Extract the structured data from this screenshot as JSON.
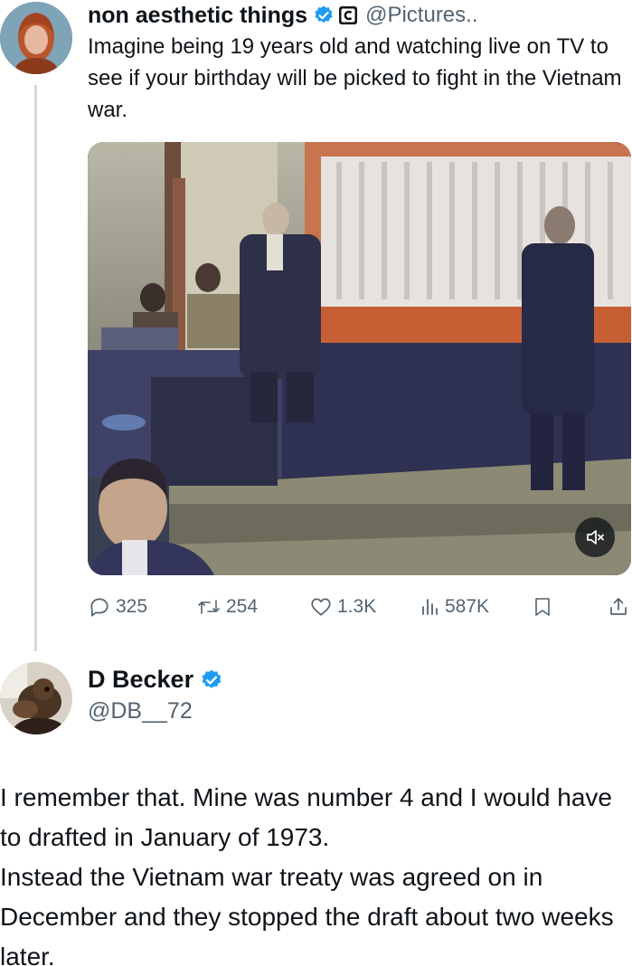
{
  "tweet": {
    "author_name": "non aesthetic things",
    "handle": "@Pictures..",
    "text": "Imagine being 19 years old and watching live on TV to see if your birthday will be picked to fight in the Vietnam war.",
    "media": {
      "kind": "video",
      "muted": true,
      "icon": "volume-muted-icon"
    },
    "stats": {
      "replies": "325",
      "retweets": "254",
      "likes": "1.3K",
      "views": "587K"
    },
    "colors": {
      "verified": "#1d9bf0",
      "muted_text": "#536471",
      "thread_line": "#cfd9de"
    }
  },
  "reply": {
    "author_name": "D Becker",
    "handle": "@DB__72",
    "paragraphs": [
      "I remember that. Mine was number 4 and I would have to drafted in January of 1973.",
      "Instead the Vietnam war treaty was agreed on in December and they stopped the draft about two weeks later."
    ]
  }
}
